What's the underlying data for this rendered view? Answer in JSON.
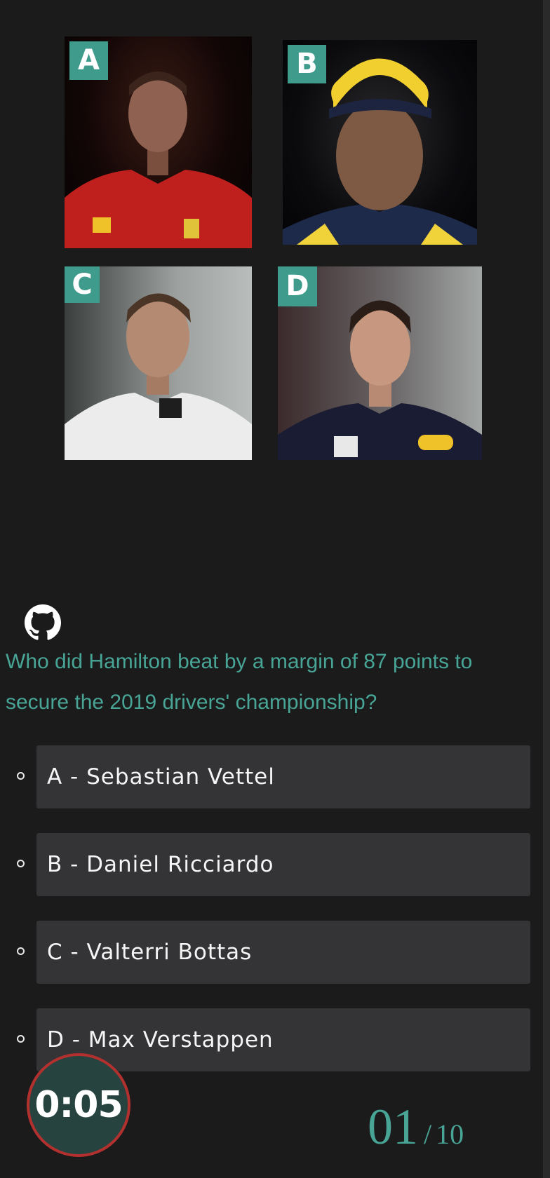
{
  "photos": [
    {
      "letter": "A"
    },
    {
      "letter": "B"
    },
    {
      "letter": "C"
    },
    {
      "letter": "D"
    }
  ],
  "question": "Who did Hamilton beat by a margin of 87 points to secure the 2019 drivers' championship?",
  "options": [
    {
      "label": "A - Sebastian Vettel"
    },
    {
      "label": "B - Daniel Ricciardo"
    },
    {
      "label": "C - Valterri Bottas"
    },
    {
      "label": "D - Max Verstappen"
    }
  ],
  "timer": "0:05",
  "progress": {
    "current": "01",
    "separator": "/",
    "total": "10"
  },
  "colors": {
    "accent": "#48a596",
    "timer_ring": "#b2302e",
    "option_bg": "#343436",
    "background": "#1b1b1c"
  },
  "icons": {
    "repo_link": "github-icon"
  }
}
